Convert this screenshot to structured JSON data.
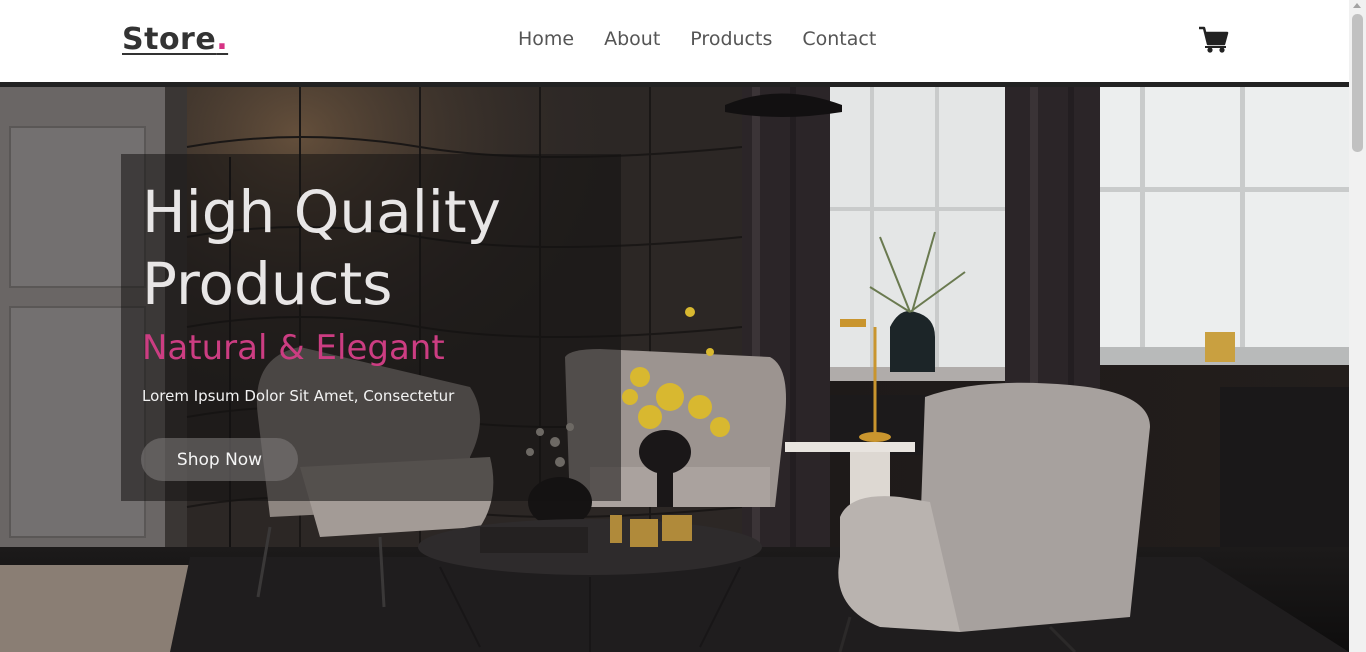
{
  "header": {
    "logo_text": "Store",
    "logo_dot": ".",
    "nav": [
      {
        "label": "Home"
      },
      {
        "label": "About"
      },
      {
        "label": "Products"
      },
      {
        "label": "Contact"
      }
    ],
    "cart_icon": "shopping-cart-icon"
  },
  "hero": {
    "title": "High Quality Products",
    "subtitle": "Natural & Elegant",
    "text": "Lorem Ipsum Dolor Sit Amet, Consectetur",
    "button_label": "Shop Now"
  },
  "colors": {
    "accent": "#cc3d82",
    "logo_dot": "#d63384",
    "header_bar": "#222222",
    "nav_text": "#555555"
  }
}
